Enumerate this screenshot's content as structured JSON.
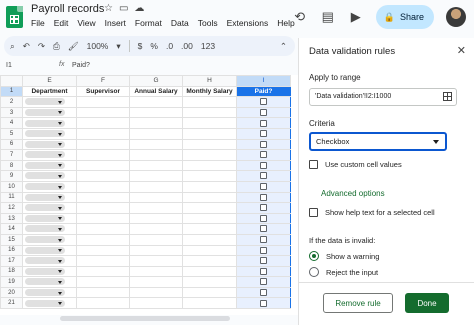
{
  "doc": {
    "title": "Payroll records",
    "menu": [
      "File",
      "Edit",
      "View",
      "Insert",
      "Format",
      "Data",
      "Tools",
      "Extensions",
      "Help"
    ]
  },
  "header": {
    "share_label": "Share"
  },
  "toolbar": {
    "zoom": "100%",
    "currency": "$",
    "percent": "%",
    "decrease_decimals": ".0",
    "increase_decimals": ".00",
    "number_format": "123"
  },
  "formula_bar": {
    "cell_ref": "I1",
    "fx": "fx",
    "value": "Paid?"
  },
  "sheet": {
    "columns": [
      "E",
      "F",
      "G",
      "H",
      "I"
    ],
    "headers": [
      "Department",
      "Supervisor",
      "Annual Salary",
      "Monthly Salary",
      "Paid?"
    ],
    "rows": [
      "1",
      "2",
      "3",
      "4",
      "5",
      "6",
      "7",
      "8",
      "9",
      "10",
      "11",
      "12",
      "13",
      "14",
      "15",
      "16",
      "17",
      "18",
      "19",
      "20",
      "21"
    ]
  },
  "panel": {
    "title": "Data validation rules",
    "apply_label": "Apply to range",
    "range_value": "'Data validation'!I2:I1000",
    "criteria_label": "Criteria",
    "criteria_value": "Checkbox",
    "custom_values_label": "Use custom cell values",
    "advanced_label": "Advanced options",
    "help_text_label": "Show help text for a selected cell",
    "invalid_label": "If the data is invalid:",
    "warning_label": "Show a warning",
    "reject_label": "Reject the input",
    "remove_label": "Remove rule",
    "done_label": "Done"
  },
  "colors": {
    "accent_green": "#146c2e",
    "share_bg": "#c2e7ff",
    "selection": "#1a73e8"
  }
}
